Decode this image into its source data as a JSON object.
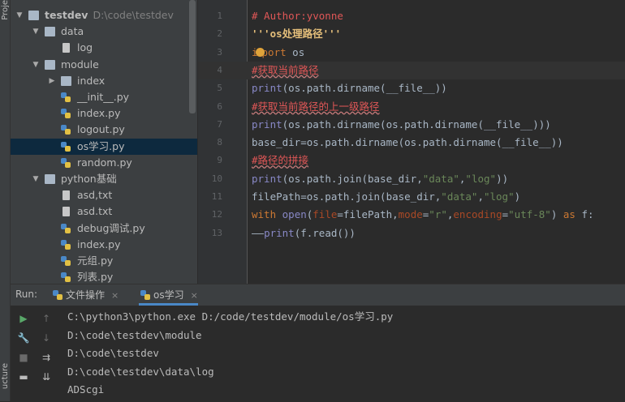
{
  "side_strip": {
    "top_label": "Proje",
    "bottom_label": "ucture"
  },
  "project_tree": [
    {
      "level": 0,
      "expanded": true,
      "icon": "folder",
      "label": "testdev",
      "path": "D:\\code\\testdev"
    },
    {
      "level": 1,
      "expanded": true,
      "icon": "folder",
      "label": "data"
    },
    {
      "level": 2,
      "icon": "file",
      "label": "log"
    },
    {
      "level": 1,
      "expanded": true,
      "icon": "folder",
      "label": "module"
    },
    {
      "level": 2,
      "expanded": false,
      "icon": "folder",
      "label": "index"
    },
    {
      "level": 2,
      "icon": "py",
      "label": "__init__.py"
    },
    {
      "level": 2,
      "icon": "py",
      "label": "index.py"
    },
    {
      "level": 2,
      "icon": "py",
      "label": "logout.py"
    },
    {
      "level": 2,
      "icon": "py",
      "label": "os学习.py",
      "selected": true
    },
    {
      "level": 2,
      "icon": "py",
      "label": "random.py"
    },
    {
      "level": 1,
      "expanded": true,
      "icon": "folder",
      "label": "python基础"
    },
    {
      "level": 2,
      "icon": "file",
      "label": "asd,txt"
    },
    {
      "level": 2,
      "icon": "file",
      "label": "asd.txt"
    },
    {
      "level": 2,
      "icon": "py",
      "label": "debug调试.py"
    },
    {
      "level": 2,
      "icon": "py",
      "label": "index.py"
    },
    {
      "level": 2,
      "icon": "py",
      "label": "元组.py"
    },
    {
      "level": 2,
      "icon": "py",
      "label": "列表.py"
    }
  ],
  "editor": {
    "current_line": 4,
    "lines": [
      {
        "n": "1",
        "segs": [
          {
            "t": "# Author:yvonne",
            "c": "cmt-red"
          }
        ]
      },
      {
        "n": "2",
        "segs": [
          {
            "t": "'''os处理路径'''",
            "c": "doc-str"
          }
        ]
      },
      {
        "n": "3",
        "segs": [
          {
            "t": "i",
            "c": "kw"
          },
          {
            "t": "",
            "c": "bulb"
          },
          {
            "t": "port",
            "c": "kw"
          },
          {
            "t": " os",
            "c": ""
          }
        ]
      },
      {
        "n": "4",
        "segs": [
          {
            "t": "#获取当前路径",
            "c": "cmt-red underline"
          }
        ]
      },
      {
        "n": "5",
        "segs": [
          {
            "t": "print",
            "c": "builtin"
          },
          {
            "t": "(os.path.dirname(__file__))",
            "c": ""
          }
        ]
      },
      {
        "n": "6",
        "segs": [
          {
            "t": "#获取当前路径的上一级路径",
            "c": "cmt-red underline"
          }
        ]
      },
      {
        "n": "7",
        "segs": [
          {
            "t": "print",
            "c": "builtin"
          },
          {
            "t": "(os.path.dirname(os.path.dirname(__file__)))",
            "c": ""
          }
        ]
      },
      {
        "n": "8",
        "segs": [
          {
            "t": "base_dir=os.path.dirname(os.path.dirname(__file__))",
            "c": ""
          }
        ]
      },
      {
        "n": "9",
        "segs": [
          {
            "t": "#路径的拼接",
            "c": "cmt-red underline"
          }
        ]
      },
      {
        "n": "10",
        "segs": [
          {
            "t": "print",
            "c": "builtin"
          },
          {
            "t": "(os.path.join(base_dir,",
            "c": ""
          },
          {
            "t": "\"data\"",
            "c": "str"
          },
          {
            "t": ",",
            "c": ""
          },
          {
            "t": "\"log\"",
            "c": "str"
          },
          {
            "t": "))",
            "c": ""
          }
        ]
      },
      {
        "n": "11",
        "segs": [
          {
            "t": "filePath=os.path.join(base_dir,",
            "c": ""
          },
          {
            "t": "\"data\"",
            "c": "str"
          },
          {
            "t": ",",
            "c": ""
          },
          {
            "t": "\"log\"",
            "c": "str"
          },
          {
            "t": ")",
            "c": ""
          }
        ]
      },
      {
        "n": "12",
        "segs": [
          {
            "t": "with ",
            "c": "kw"
          },
          {
            "t": "open",
            "c": "builtin"
          },
          {
            "t": "(",
            "c": ""
          },
          {
            "t": "file",
            "c": "param"
          },
          {
            "t": "=filePath,",
            "c": ""
          },
          {
            "t": "mode",
            "c": "param"
          },
          {
            "t": "=",
            "c": ""
          },
          {
            "t": "\"r\"",
            "c": "str"
          },
          {
            "t": ",",
            "c": ""
          },
          {
            "t": "encoding",
            "c": "param"
          },
          {
            "t": "=",
            "c": ""
          },
          {
            "t": "\"utf-8\"",
            "c": "str"
          },
          {
            "t": ") ",
            "c": ""
          },
          {
            "t": "as",
            "c": "kw"
          },
          {
            "t": " f:",
            "c": ""
          }
        ]
      },
      {
        "n": "13",
        "segs": [
          {
            "t": "——",
            "c": ""
          },
          {
            "t": "print",
            "c": "builtin"
          },
          {
            "t": "(f.read())",
            "c": ""
          }
        ]
      }
    ]
  },
  "run_panel": {
    "label": "Run:",
    "tabs": [
      {
        "label": "文件操作",
        "active": false
      },
      {
        "label": "os学习",
        "active": true
      }
    ],
    "console_lines": [
      "C:\\python3\\python.exe D:/code/testdev/module/os学习.py",
      "D:\\code\\testdev\\module",
      "D:\\code\\testdev",
      "D:\\code\\testdev\\data\\log",
      "ADScgi"
    ],
    "toolbar": [
      {
        "icon": "run-icon",
        "glyph": "▶",
        "color": "#59a869"
      },
      {
        "icon": "up-arrow-icon",
        "glyph": "↑",
        "color": "#6a6a6a"
      },
      {
        "icon": "wrench-icon",
        "glyph": "🔧",
        "color": "#bbbbbb"
      },
      {
        "icon": "down-arrow-icon",
        "glyph": "↓",
        "color": "#6a6a6a"
      },
      {
        "icon": "stop-icon",
        "glyph": "■",
        "color": "#6a6a6a"
      },
      {
        "icon": "soft-wrap-icon",
        "glyph": "⇉",
        "color": "#bbbbbb"
      },
      {
        "icon": "layout-icon",
        "glyph": "▬",
        "color": "#bbbbbb"
      },
      {
        "icon": "scroll-end-icon",
        "glyph": "⇊",
        "color": "#bbbbbb"
      }
    ]
  },
  "colors": {
    "accent": "#4a88c7",
    "selection": "#0d293e",
    "comment": "#e05757",
    "string": "#6a8759",
    "keyword": "#cc7832"
  }
}
